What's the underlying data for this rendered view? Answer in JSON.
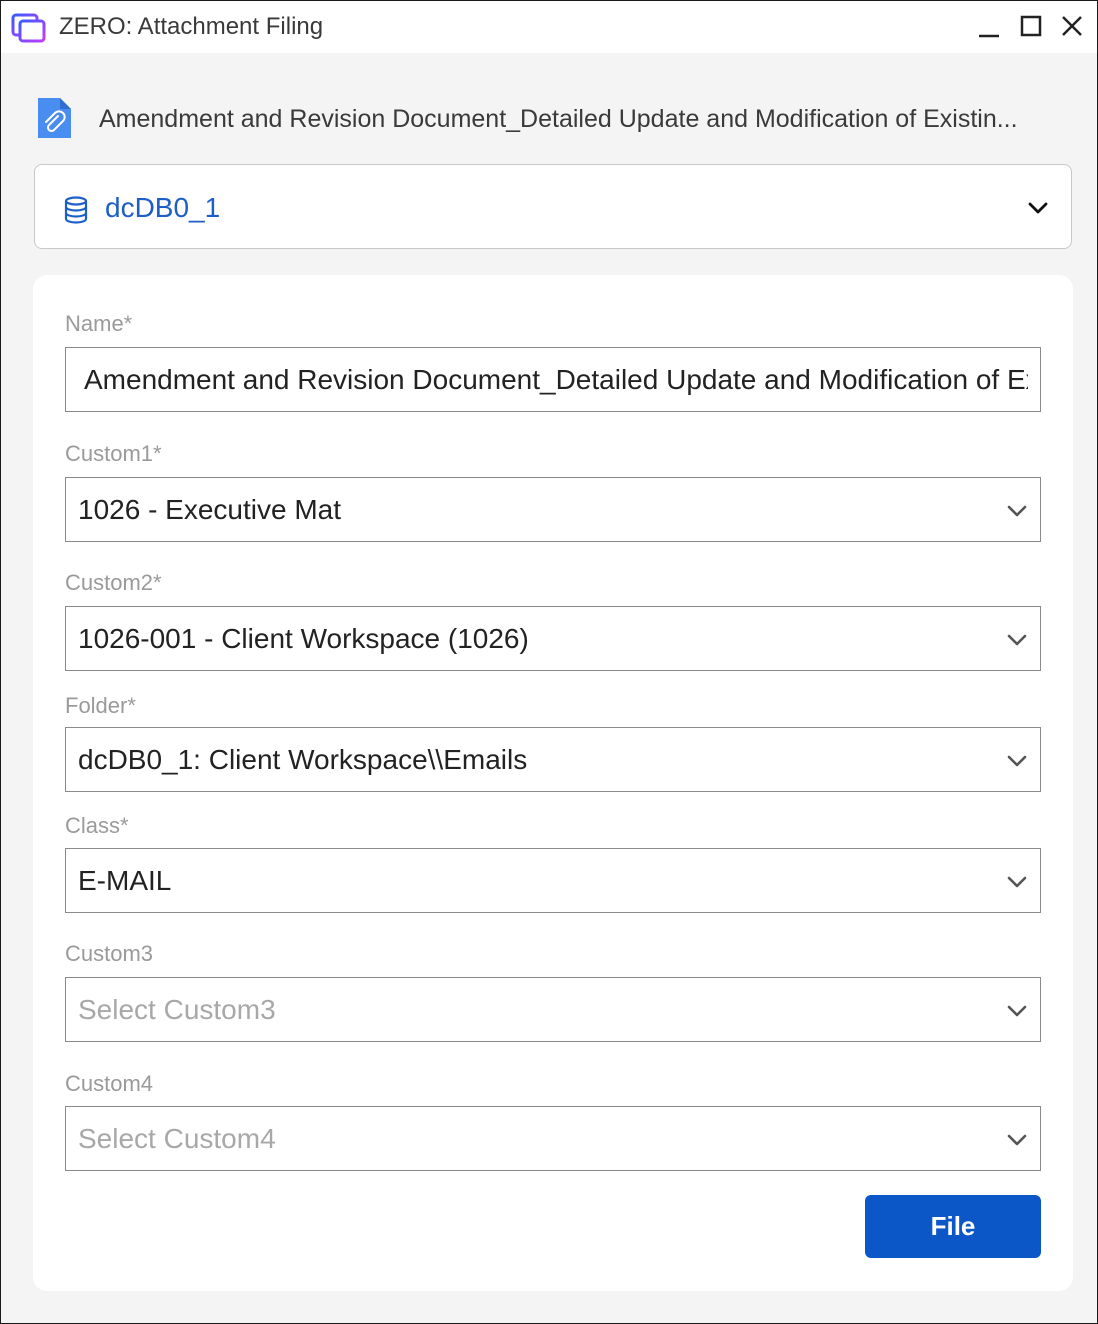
{
  "window": {
    "title": "ZERO: Attachment Filing",
    "controls": [
      "minimize-icon",
      "maximize-icon",
      "close-icon"
    ]
  },
  "document": {
    "icon": "document-attachment-icon",
    "title": "Amendment and Revision Document_Detailed Update and Modification of Existin..."
  },
  "database": {
    "icon": "database-icon",
    "name": "dcDB0_1"
  },
  "form": {
    "fields": [
      {
        "label": "Name*",
        "value": "Amendment and Revision Document_Detailed Update and Modification of Ex",
        "placeholder": ""
      },
      {
        "label": "Custom1*",
        "value": "1026 - Executive Mat",
        "placeholder": ""
      },
      {
        "label": "Custom2*",
        "value": "1026-001 - Client Workspace (1026)",
        "placeholder": ""
      },
      {
        "label": "Folder*",
        "value": "dcDB0_1: Client Workspace\\\\Emails",
        "placeholder": ""
      },
      {
        "label": "Class*",
        "value": "E-MAIL",
        "placeholder": ""
      },
      {
        "label": "Custom3",
        "value": "",
        "placeholder": "Select Custom3"
      },
      {
        "label": "Custom4",
        "value": "",
        "placeholder": "Select Custom4"
      }
    ],
    "submit_label": "File"
  },
  "colors": {
    "accent": "#0b57c8",
    "database_text": "#1d5fc8",
    "label": "#9a9a9a",
    "placeholder": "#a8a8a8"
  }
}
